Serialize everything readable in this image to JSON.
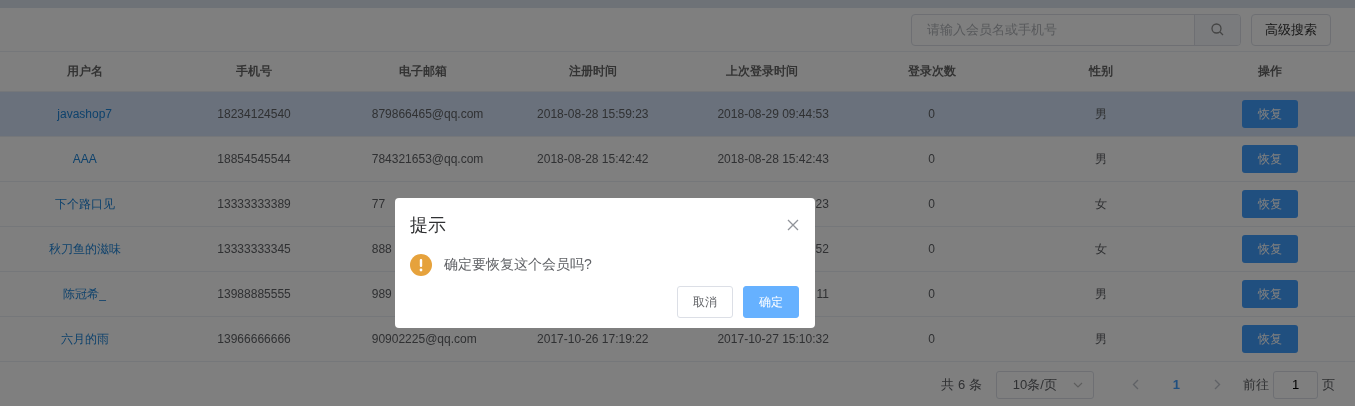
{
  "toolbar": {
    "search": {
      "placeholder": "请输入会员名或手机号"
    },
    "advanced_button": "高级搜索"
  },
  "table": {
    "columns": [
      "用户名",
      "手机号",
      "电子邮箱",
      "注册时间",
      "上次登录时间",
      "登录次数",
      "性别",
      "操作"
    ],
    "rows": [
      {
        "selected": true,
        "name": "javashop7",
        "phone": "18234124540",
        "email": "879866465@qq.com",
        "registered": "2018-08-28 15:59:23",
        "last_login": "2018-08-29 09:44:53",
        "logins": "0",
        "gender": "男",
        "action": "恢复"
      },
      {
        "selected": false,
        "name": "AAA",
        "phone": "18854545544",
        "email": "784321653@qq.com",
        "registered": "2018-08-28 15:42:42",
        "last_login": "2018-08-28 15:42:43",
        "logins": "0",
        "gender": "男",
        "action": "恢复"
      },
      {
        "selected": false,
        "name": "下个路口见",
        "phone": "13333333389",
        "email": "77",
        "last_login": "23",
        "logins": "0",
        "gender": "女",
        "action": "恢复"
      },
      {
        "selected": false,
        "name": "秋刀鱼的滋味",
        "phone": "13333333345",
        "email": "888",
        "last_login": "52",
        "logins": "0",
        "gender": "女",
        "action": "恢复"
      },
      {
        "selected": false,
        "name": "陈冠希_",
        "phone": "13988885555",
        "email": "989",
        "last_login": "11",
        "logins": "0",
        "gender": "男",
        "action": "恢复"
      },
      {
        "selected": false,
        "name": "六月的雨",
        "phone": "13966666666",
        "email": "90902225@qq.com",
        "registered": "2017-10-26 17:19:22",
        "last_login": "2017-10-27 15:10:32",
        "logins": "0",
        "gender": "男",
        "action": "恢复"
      }
    ]
  },
  "pagination": {
    "total": "共 6 条",
    "page_size": "10条/页",
    "pages": [
      {
        "label": "1",
        "selected": true
      }
    ],
    "goto_label": "前往",
    "goto_value": "1",
    "goto_suffix": "页"
  },
  "dialog": {
    "title": "提示",
    "message": "确定要恢复这个会员吗?",
    "buttons": [
      {
        "kind": "cancel",
        "label": "取消"
      },
      {
        "kind": "confirm",
        "label": "确定"
      }
    ]
  }
}
